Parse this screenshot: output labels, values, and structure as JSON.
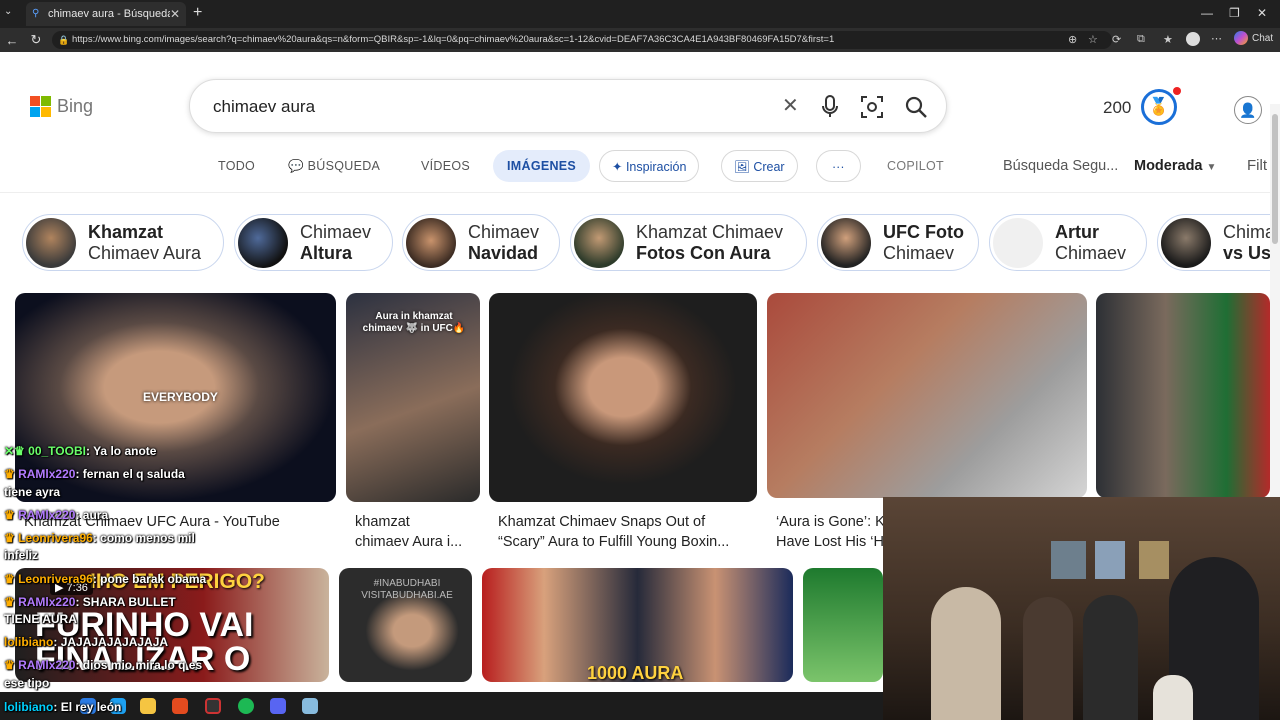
{
  "browser": {
    "tab_title": "chimaev aura - Búsqueda Imágenes",
    "url": "https://www.bing.com/images/search?q=chimaev%20aura&qs=n&form=QBIR&sp=-1&lq=0&pq=chimaev%20aura&sc=1-12&cvid=DEAF7A36C3CA4E1A943BF80469FA15D7&first=1",
    "copilot_label": "Chat"
  },
  "header": {
    "logo_text": "Bing",
    "search_value": "chimaev aura",
    "points": "200"
  },
  "nav": {
    "todo": "TODO",
    "busqueda": "BÚSQUEDA",
    "videos": "VÍDEOS",
    "imagenes": "IMÁGENES",
    "inspiracion": "Inspiración",
    "crear": "Crear",
    "more": "···",
    "copilot": "COPILOT",
    "safe_label": "Búsqueda Segu...",
    "safe_value": "Moderada",
    "filter": "Filt"
  },
  "chips": [
    {
      "a": "Khamzat",
      "b": "Chimaev Aura",
      "bold": "a"
    },
    {
      "a": "Chimaev",
      "b": "Altura",
      "bold": "b"
    },
    {
      "a": "Chimaev",
      "b": "Navidad",
      "bold": "b"
    },
    {
      "a": "Khamzat Chimaev",
      "b": "Fotos Con Aura",
      "bold": "b"
    },
    {
      "a": "UFC Foto",
      "b": "Chimaev",
      "bold": "a"
    },
    {
      "a": "Artur",
      "b": "Chimaev",
      "bold": "a"
    },
    {
      "a": "Chima",
      "b": "vs Us",
      "bold": "b"
    }
  ],
  "results": {
    "r1": {
      "overlay": "EVERYBODY",
      "caption": "Khamzat Chimaev UFC Aura - YouTube"
    },
    "r2": {
      "overlay": "Aura in khamzat chimaev 🐺 in UFC🔥",
      "caption1": "khamzat",
      "caption2": "chimaev Aura i..."
    },
    "r3": {
      "caption1": "Khamzat Chimaev Snaps Out of",
      "caption2": "“Scary” Aura to Fulfill Young Boxin..."
    },
    "r4": {
      "caption1": "‘Aura is Gone’: K",
      "caption2": "Have Lost His ‘H"
    },
    "r6": {
      "overlay_top": "IHO EM PERIGO?",
      "overlay_bottom": "FURINHO VAI FINALIZAR O",
      "duration": "▶ 7:36"
    },
    "r7": {
      "overlay": "#INABUDHABI VISITABUDHABI.AE"
    },
    "r8": {
      "overlay": "1000 AURA"
    }
  },
  "chat": [
    {
      "user": "00_TOOBI",
      "msg": "Ya lo anote",
      "color": "u1"
    },
    {
      "user": "RAMlx220",
      "msg": "fernan el q saluda",
      "color": "u3"
    },
    {
      "user": "",
      "msg": "tiene ayra",
      "color": ""
    },
    {
      "user": "RAMlx220",
      "msg": "aura",
      "color": "u3"
    },
    {
      "user": "Leonrivera96",
      "msg": "como menos mil",
      "color": "u2"
    },
    {
      "user": "",
      "msg": "infeliz",
      "color": ""
    },
    {
      "user": "Leonrivera96",
      "msg": "pone barak obama",
      "color": "u2"
    },
    {
      "user": "RAMlx220",
      "msg": "SHARA BULLET",
      "color": "u3"
    },
    {
      "user": "",
      "msg": "TIENE AURA",
      "color": ""
    },
    {
      "user": "lolibiano",
      "msg": "JAJAJAJAJAJAJA",
      "color": "u2"
    },
    {
      "user": "RAMlx220",
      "msg": "dios mio mira lo q es",
      "color": "u3"
    },
    {
      "user": "",
      "msg": "ese tipo",
      "color": ""
    },
    {
      "user": "lolibiano",
      "msg": "El rey león",
      "color": "u1"
    }
  ],
  "colors": {
    "accent": "#1d4fa3",
    "active_bg": "#e4ecfb",
    "reward": "#1a6fd8"
  }
}
